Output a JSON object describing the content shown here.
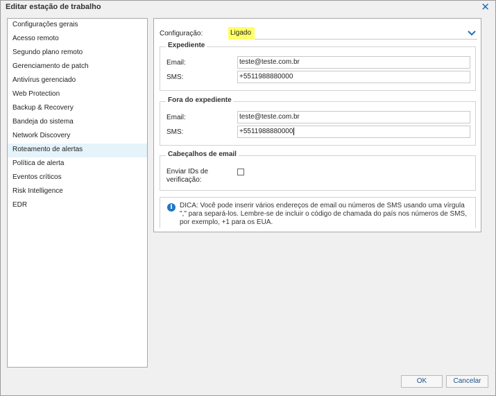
{
  "window": {
    "title": "Editar estação de trabalho",
    "close_glyph": "✕"
  },
  "sidebar": {
    "items": [
      {
        "label": "Configurações gerais"
      },
      {
        "label": "Acesso remoto"
      },
      {
        "label": "Segundo plano remoto"
      },
      {
        "label": "Gerenciamento de patch"
      },
      {
        "label": "Antivírus gerenciado"
      },
      {
        "label": "Web Protection"
      },
      {
        "label": "Backup & Recovery"
      },
      {
        "label": "Bandeja do sistema"
      },
      {
        "label": "Network Discovery"
      },
      {
        "label": "Roteamento de alertas",
        "selected": true
      },
      {
        "label": "Política de alerta"
      },
      {
        "label": "Eventos críticos"
      },
      {
        "label": "Risk Intelligence"
      },
      {
        "label": "EDR"
      }
    ]
  },
  "config": {
    "label": "Configuração:",
    "value": "Ligado",
    "highlight_color": "#ffff66",
    "dropdown_icon": "chevron-down-icon"
  },
  "expediente": {
    "legend": "Expediente",
    "email_label": "Email:",
    "email_value": "teste@teste.com.br",
    "sms_label": "SMS:",
    "sms_value": "+5511988880000"
  },
  "fora": {
    "legend": "Fora do expediente",
    "email_label": "Email:",
    "email_value": "teste@teste.com.br",
    "sms_label": "SMS:",
    "sms_value": "+5511988880000"
  },
  "headers": {
    "legend": "Cabeçalhos de email",
    "checkbox_label": "Enviar IDs de verificação:",
    "checked": false
  },
  "tip": {
    "icon": "info-icon",
    "icon_glyph": "i",
    "text": "DICA: Você pode inserir vários endereços de email ou números de SMS usando uma vírgula \",\" para separá-los. Lembre-se de incluir o código de chamada do país nos números de SMS, por exemplo, +1 para os EUA."
  },
  "buttons": {
    "ok": "OK",
    "cancel": "Cancelar"
  },
  "colors": {
    "accent": "#1b6fb5",
    "selected_bg": "#e5f3fb",
    "info_blue": "#1f76c8"
  }
}
